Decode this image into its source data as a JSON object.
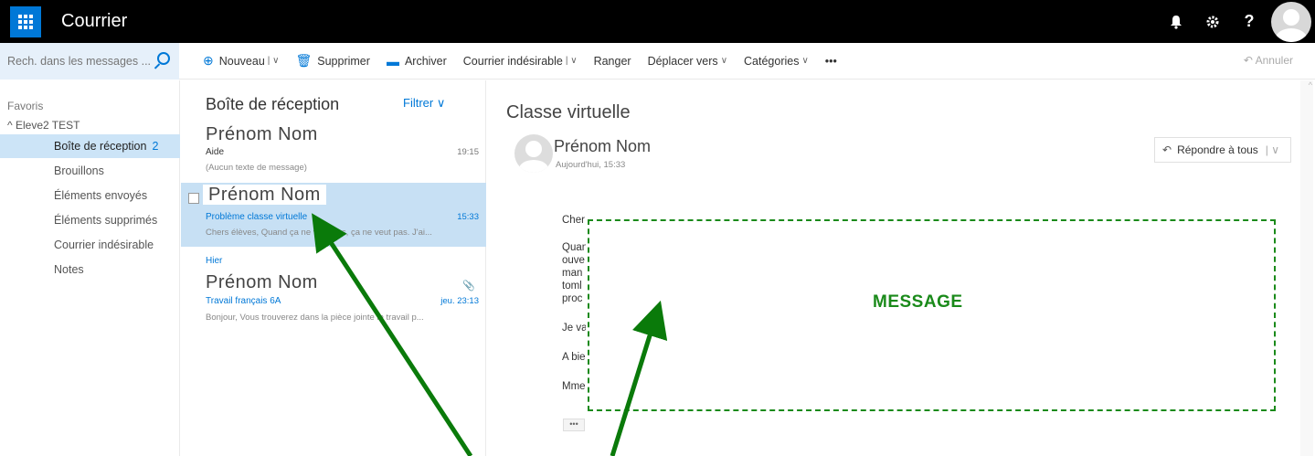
{
  "app": {
    "title": "Courrier",
    "accent": "#0078d7"
  },
  "topbar": {
    "icons": [
      "bell-icon",
      "gear-icon",
      "help-icon",
      "avatar"
    ],
    "help_glyph": "?"
  },
  "search": {
    "placeholder": "Rech. dans les messages ..."
  },
  "commands": {
    "new": "Nouveau",
    "delete": "Supprimer",
    "archive": "Archiver",
    "junk": "Courrier indésirable",
    "sweep": "Ranger",
    "move": "Déplacer vers",
    "categories": "Catégories",
    "more": "•••",
    "undo": "Annuler"
  },
  "folders": {
    "favorites_label": "Favoris",
    "account": "Eleve2 TEST",
    "items": [
      {
        "label": "Boîte de réception",
        "count": "2"
      },
      {
        "label": "Brouillons"
      },
      {
        "label": "Éléments envoyés"
      },
      {
        "label": "Éléments supprimés"
      },
      {
        "label": "Courrier indésirable"
      },
      {
        "label": "Notes"
      }
    ]
  },
  "list": {
    "title": "Boîte de réception",
    "filter": "Filtrer",
    "group_yesterday": "Hier",
    "messages": [
      {
        "sender": "Prénom Nom",
        "subject": "Aide",
        "preview": "(Aucun texte de message)",
        "time": "19:15"
      },
      {
        "sender": "Prénom Nom",
        "subject": "Problème classe virtuelle",
        "preview": "Chers élèves, Quand ça ne veut pas, ça ne veut pas. J'ai...",
        "time": "15:33"
      },
      {
        "sender": "Prénom Nom",
        "subject": "Travail français 6A",
        "preview": "Bonjour, Vous trouverez dans la pièce jointe le travail p...",
        "time": "jeu. 23:13"
      }
    ]
  },
  "reading": {
    "subject": "Classe virtuelle",
    "from": "Prénom Nom",
    "date": "Aujourd'hui, 15:33",
    "reply_all": "Répondre à tous",
    "body_lines": [
      "Cher",
      "Quan",
      "ouve",
      "man",
      "toml",
      "proc",
      "Je va",
      "A bie",
      "Mme"
    ],
    "more": "•••",
    "overlay_label": "MESSAGE",
    "overlay_color": "#1a8a1a"
  }
}
